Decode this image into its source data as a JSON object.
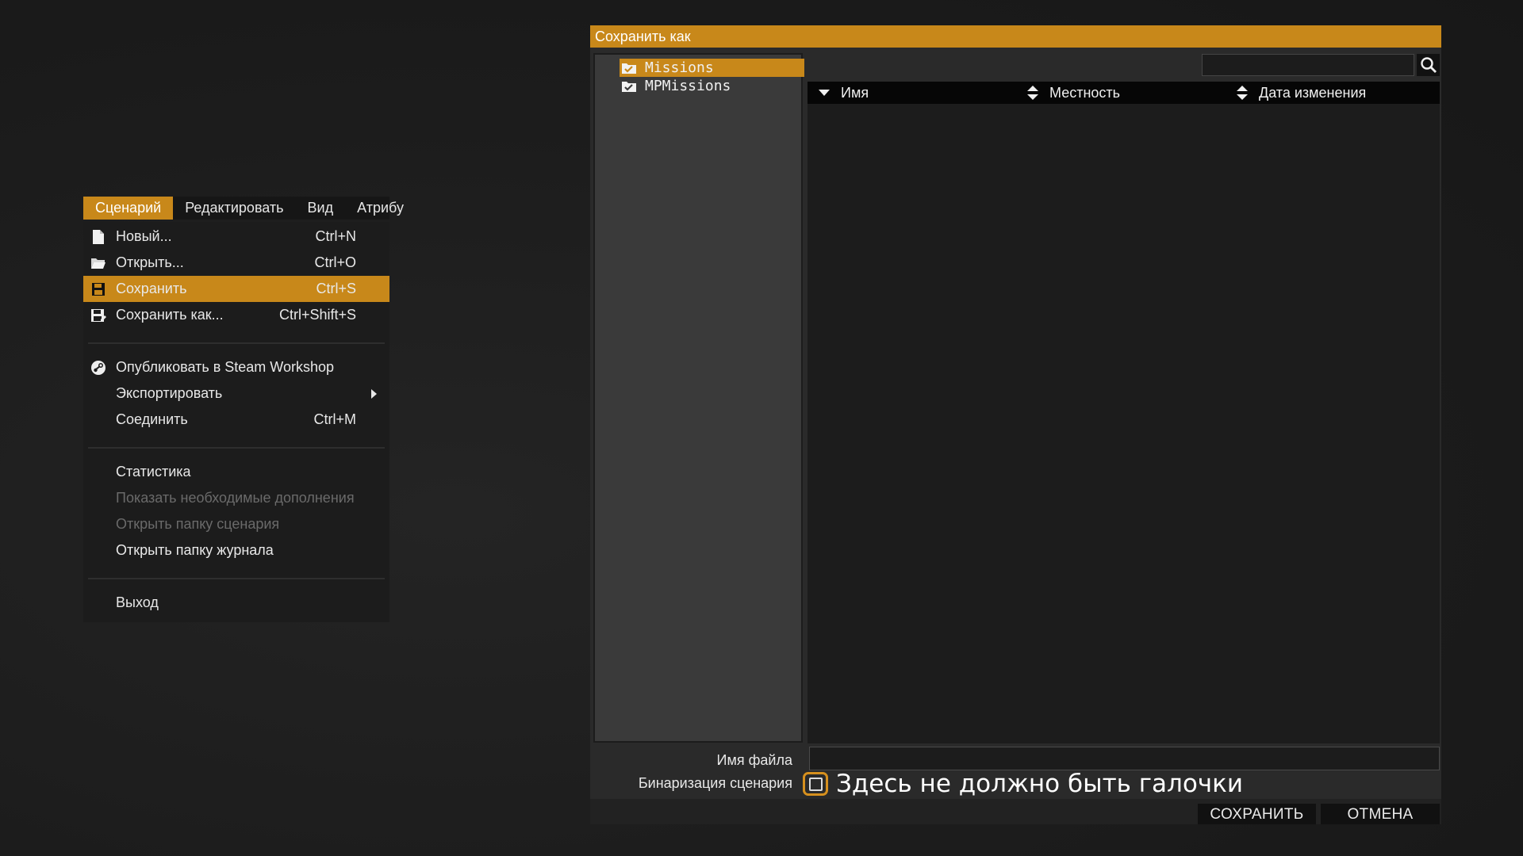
{
  "menubar": {
    "items": [
      {
        "label": "Сценарий",
        "active": true
      },
      {
        "label": "Редактировать"
      },
      {
        "label": "Вид"
      },
      {
        "label": "Атрибу"
      }
    ]
  },
  "menu": {
    "new": {
      "label": "Новый...",
      "shortcut": "Ctrl+N",
      "icon": "file-icon"
    },
    "open": {
      "label": "Открыть...",
      "shortcut": "Ctrl+O",
      "icon": "folder-icon"
    },
    "save": {
      "label": "Сохранить",
      "shortcut": "Ctrl+S",
      "icon": "floppy-icon"
    },
    "save_as": {
      "label": "Сохранить как...",
      "shortcut": "Ctrl+Shift+S",
      "icon": "floppy-edit-icon"
    },
    "publish": {
      "label": "Опубликовать в Steam Workshop",
      "icon": "steam-icon"
    },
    "export": {
      "label": "Экспортировать"
    },
    "merge": {
      "label": "Соединить",
      "shortcut": "Ctrl+M"
    },
    "stats": {
      "label": "Статистика"
    },
    "show_addons": {
      "label": "Показать необходимые дополнения"
    },
    "open_scenario_folder": {
      "label": "Открыть папку сценария"
    },
    "open_log_folder": {
      "label": "Открыть папку журнала"
    },
    "exit": {
      "label": "Выход"
    }
  },
  "dialog": {
    "title": "Сохранить как",
    "tree": [
      {
        "label": "Missions",
        "selected": true
      },
      {
        "label": "MPMissions"
      }
    ],
    "search": {
      "value": ""
    },
    "columns": {
      "name": "Имя",
      "terrain": "Местность",
      "modified": "Дата изменения"
    },
    "filename_label": "Имя файла",
    "filename_value": "",
    "binarize_label": "Бинаризация сценария",
    "binarize_checked": false,
    "annotation": "Здесь не должно быть галочки",
    "save_button": "СОХРАНИТЬ",
    "cancel_button": "ОТМЕНА"
  },
  "colors": {
    "accent": "#c8881a",
    "checkbox_highlight": "#d6901e",
    "background": "#1c1c1c",
    "panel": "#3a3a3a"
  }
}
